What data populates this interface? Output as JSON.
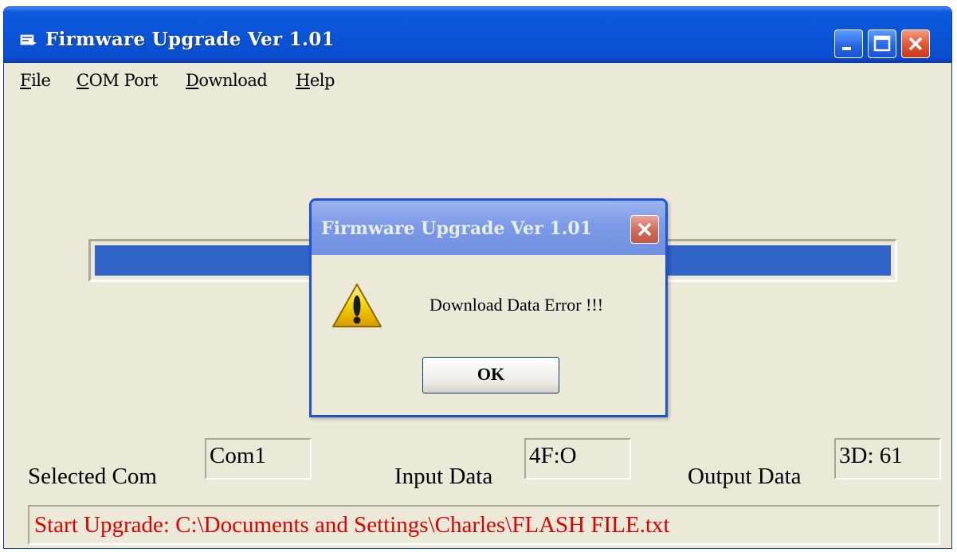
{
  "window": {
    "title": "Firmware Upgrade Ver 1.01"
  },
  "menu": {
    "items": [
      {
        "label": "File"
      },
      {
        "label": "COM Port"
      },
      {
        "label": "Download"
      },
      {
        "label": "Help"
      }
    ]
  },
  "progress": {
    "fraction": 1.0,
    "color": "#3264c8"
  },
  "fields": {
    "selected_com_label": "Selected Com",
    "selected_com_value": "Com1",
    "input_data_label": "Input Data",
    "input_data_value": "4F:O",
    "output_data_label": "Output Data",
    "output_data_value": "3D: 61"
  },
  "status": {
    "text": "Start Upgrade: C:\\Documents and Settings\\Charles\\FLASH FILE.txt",
    "color": "#e00000"
  },
  "dialog": {
    "title": "Firmware Upgrade Ver 1.01",
    "message": "Download Data Error !!!",
    "ok_label": "OK",
    "icon": "warning-icon"
  },
  "colors": {
    "titlebar": "#0a54d6",
    "window_bg": "#ece9d8",
    "close_button": "#e45430"
  }
}
